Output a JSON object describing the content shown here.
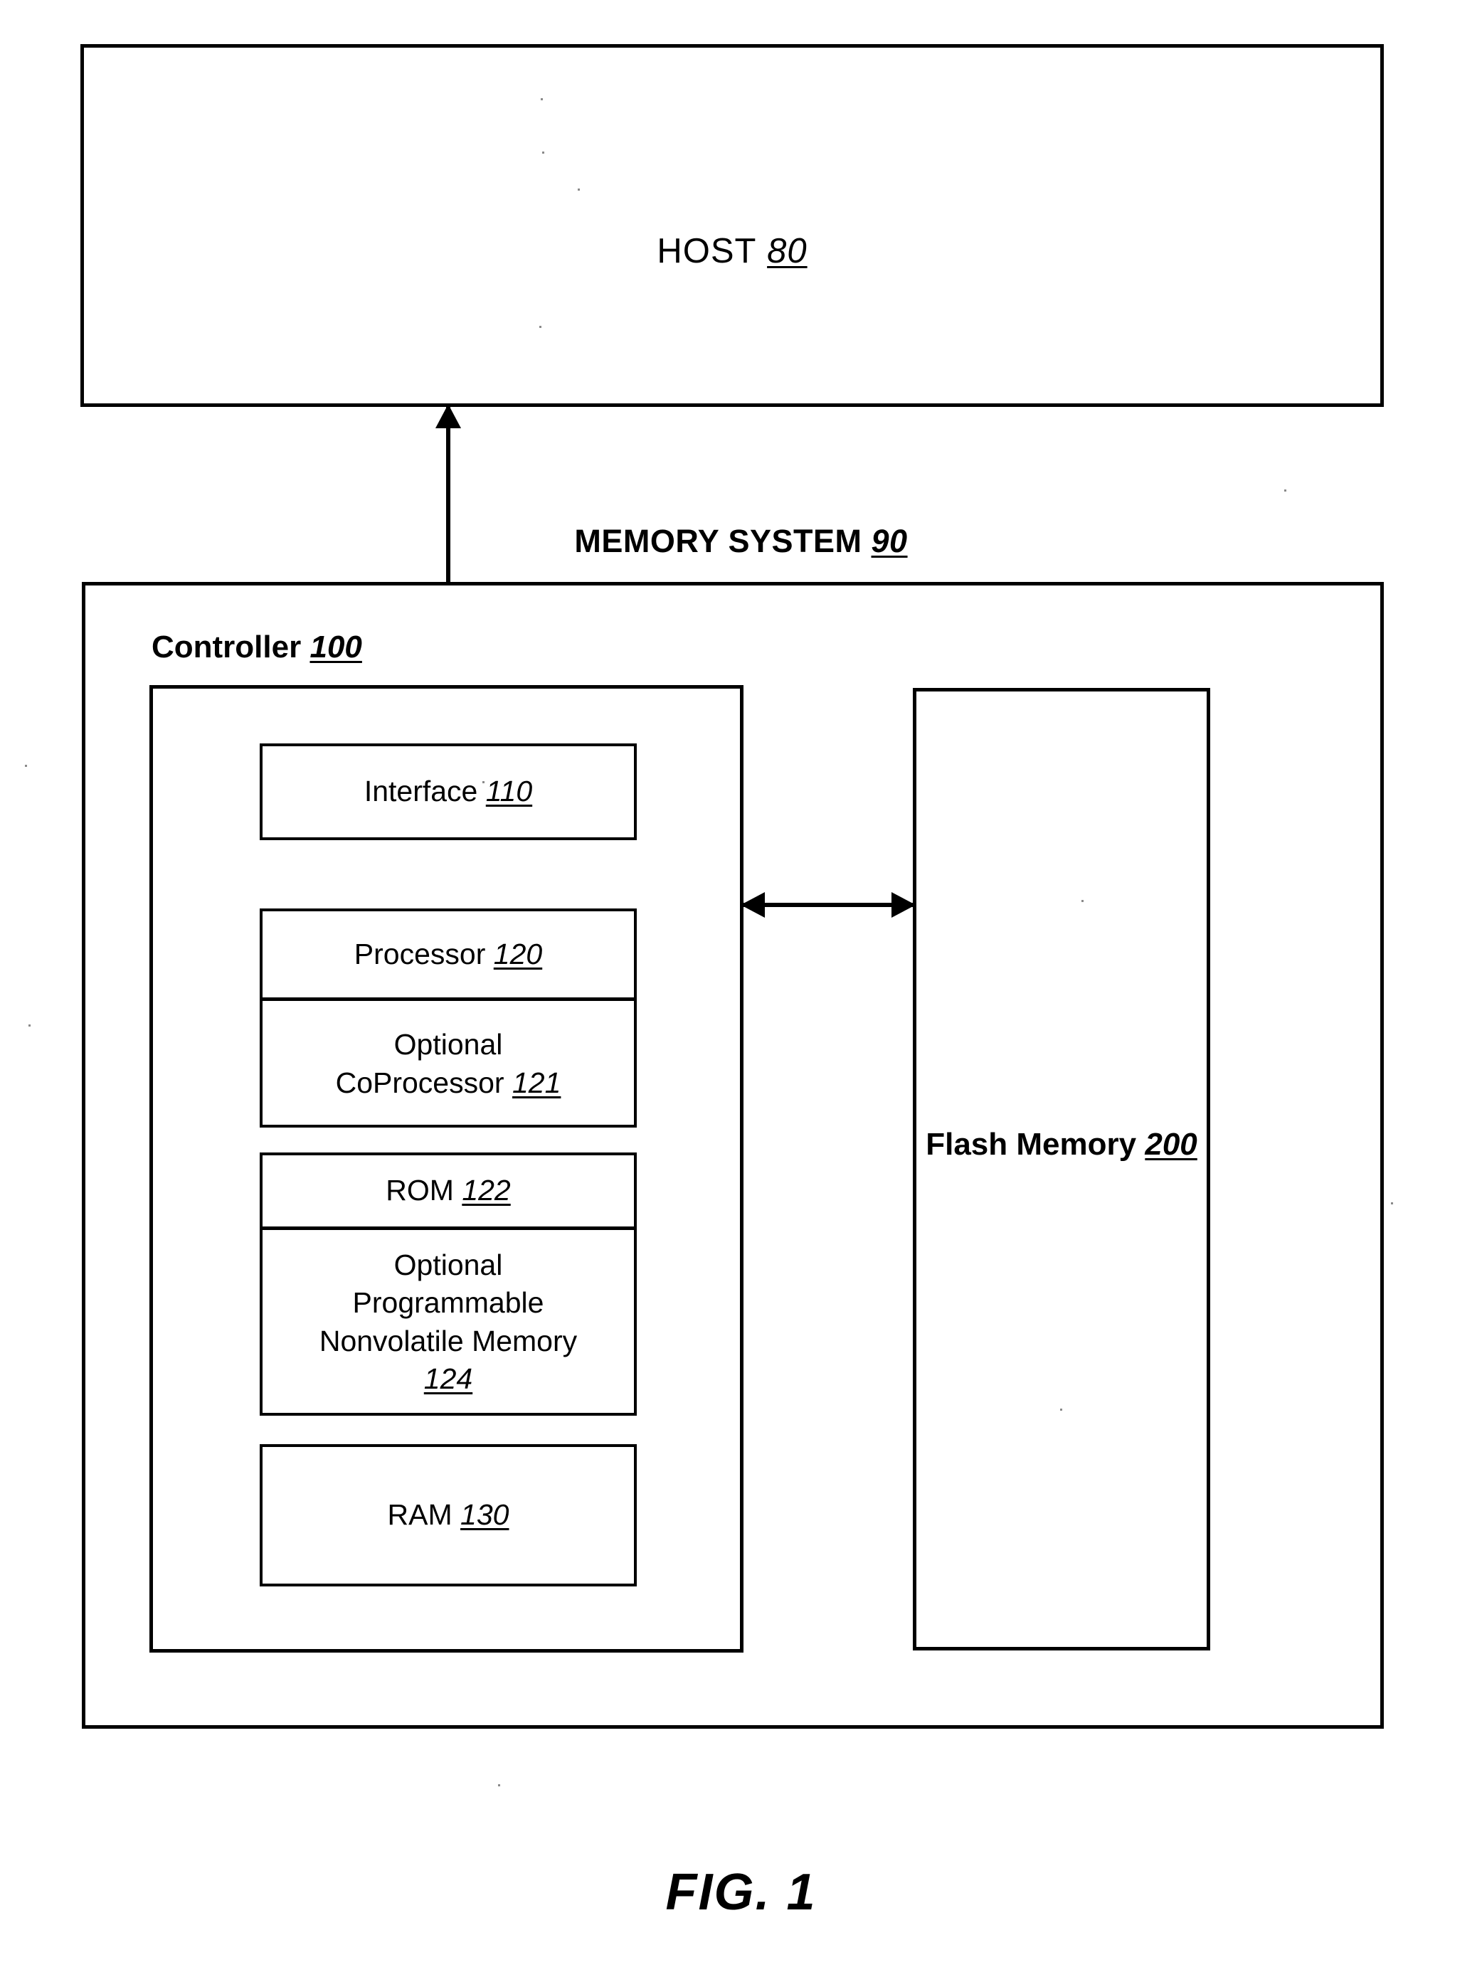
{
  "figure": {
    "caption": "FIG. 1"
  },
  "host": {
    "label": "HOST",
    "ref": "80"
  },
  "memory_system": {
    "title": "MEMORY SYSTEM",
    "ref": "90"
  },
  "controller": {
    "title": "Controller",
    "ref": "100",
    "blocks": {
      "interface": {
        "label": "Interface",
        "ref": "110"
      },
      "processor": {
        "label": "Processor",
        "ref": "120"
      },
      "coprocessor": {
        "line1": "Optional",
        "line2": "CoProcessor",
        "ref": "121"
      },
      "rom": {
        "label": "ROM",
        "ref": "122"
      },
      "nonvolatile": {
        "line1": "Optional",
        "line2": "Programmable",
        "line3": "Nonvolatile Memory",
        "ref": "124"
      },
      "ram": {
        "label": "RAM",
        "ref": "130"
      }
    }
  },
  "flash_memory": {
    "label": "Flash Memory",
    "ref": "200"
  },
  "connections": {
    "host_to_controller": "bidirectional-arrow",
    "controller_to_flash": "bidirectional-arrow"
  },
  "colors": {
    "line": "#000000",
    "background": "#ffffff"
  }
}
